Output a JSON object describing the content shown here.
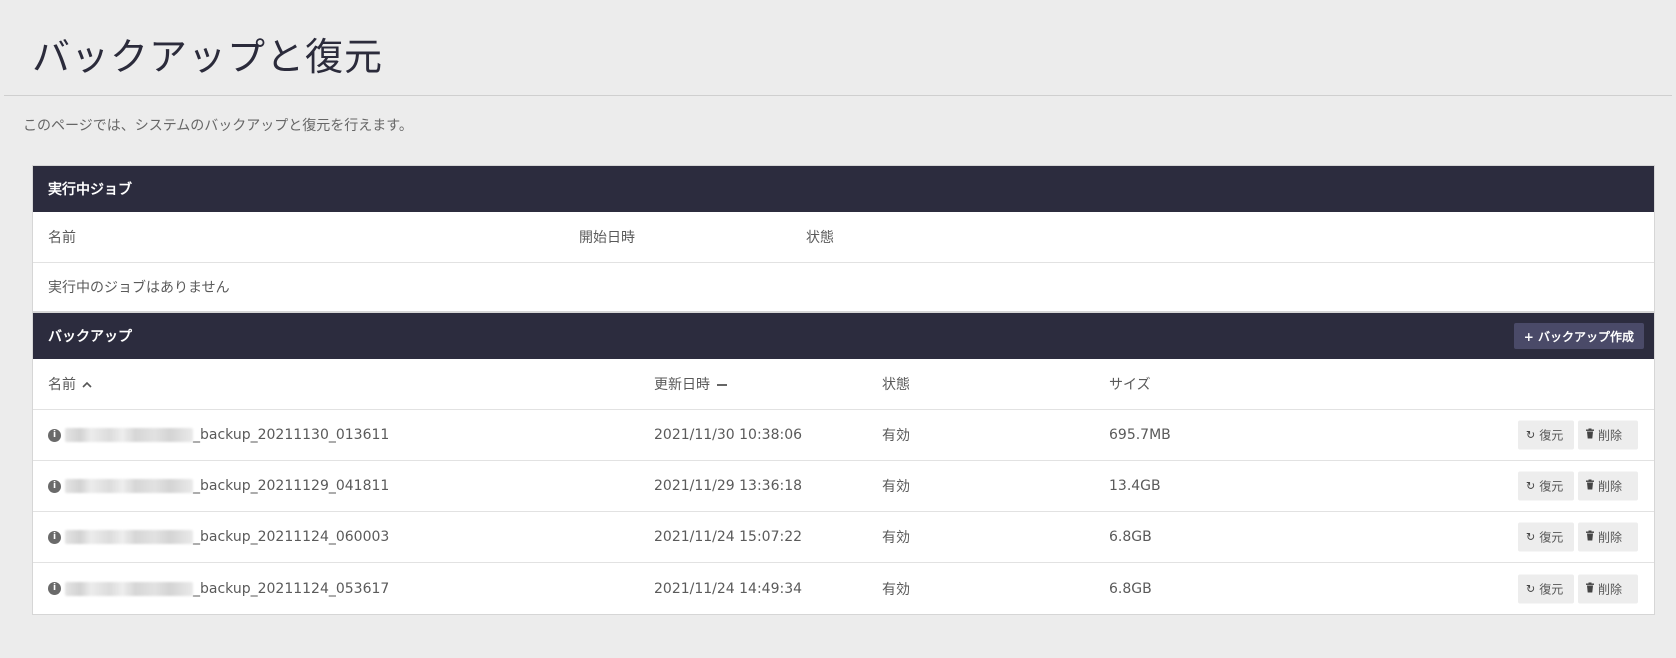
{
  "page": {
    "title": "バックアップと復元",
    "description": "このページでは、システムのバックアップと復元を行えます。"
  },
  "running_jobs": {
    "heading": "実行中ジョブ",
    "columns": {
      "name": "名前",
      "start": "開始日時",
      "status": "状態"
    },
    "empty_message": "実行中のジョブはありません"
  },
  "backups": {
    "heading": "バックアップ",
    "create_label": "+ バックアップ作成",
    "columns": {
      "name": "名前",
      "updated": "更新日時",
      "status": "状態",
      "size": "サイズ"
    },
    "restore_label": "復元",
    "delete_label": "削除",
    "rows": [
      {
        "name": "_backup_20211130_013611",
        "updated": "2021/11/30 10:38:06",
        "status": "有効",
        "size": "695.7MB"
      },
      {
        "name": "_backup_20211129_041811",
        "updated": "2021/11/29 13:36:18",
        "status": "有効",
        "size": "13.4GB"
      },
      {
        "name": "_backup_20211124_060003",
        "updated": "2021/11/24 15:07:22",
        "status": "有効",
        "size": "6.8GB"
      },
      {
        "name": "_backup_20211124_053617",
        "updated": "2021/11/24 14:49:34",
        "status": "有効",
        "size": "6.8GB"
      }
    ]
  },
  "icons": {
    "sort_name": "chevron-up-icon",
    "sort_updated": "minus-icon",
    "info": "info-icon",
    "restore": "refresh-icon",
    "delete": "trash-icon"
  },
  "colors": {
    "header_bg": "#2c2c3e",
    "button_bg": "#4a4a68",
    "page_bg": "#ececec"
  }
}
